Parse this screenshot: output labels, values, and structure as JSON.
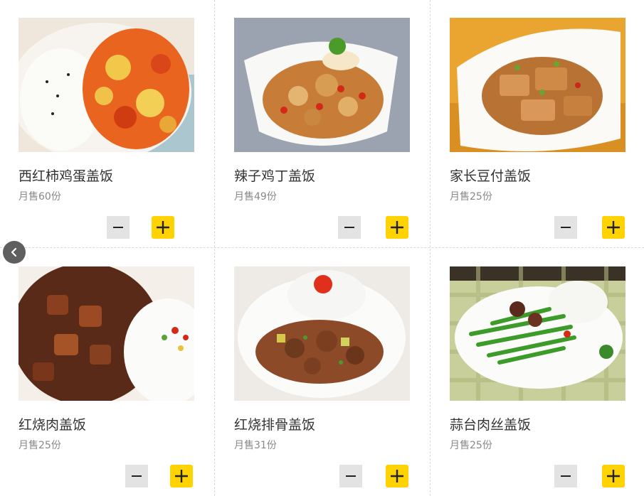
{
  "dishes": [
    {
      "name": "西红柿鸡蛋盖饭",
      "sales": "月售60份",
      "image": "tomato-egg-rice"
    },
    {
      "name": "辣子鸡丁盖饭",
      "sales": "月售49份",
      "image": "spicy-chicken-rice"
    },
    {
      "name": "家长豆付盖饭",
      "sales": "月售25份",
      "image": "home-style-tofu-rice"
    },
    {
      "name": "红烧肉盖饭",
      "sales": "月售25份",
      "image": "braised-pork-rice"
    },
    {
      "name": "红烧排骨盖饭",
      "sales": "月售31份",
      "image": "braised-ribs-rice"
    },
    {
      "name": "蒜台肉丝盖饭",
      "sales": "月售25份",
      "image": "garlic-stem-pork-rice"
    }
  ],
  "icons": {
    "minus": "minus-icon",
    "plus": "plus-icon",
    "prev": "chevron-left-icon"
  },
  "colors": {
    "plus_button": "#ffd300",
    "minus_button": "#e3e3e3",
    "nav_arrow": "#5f5f5f"
  }
}
